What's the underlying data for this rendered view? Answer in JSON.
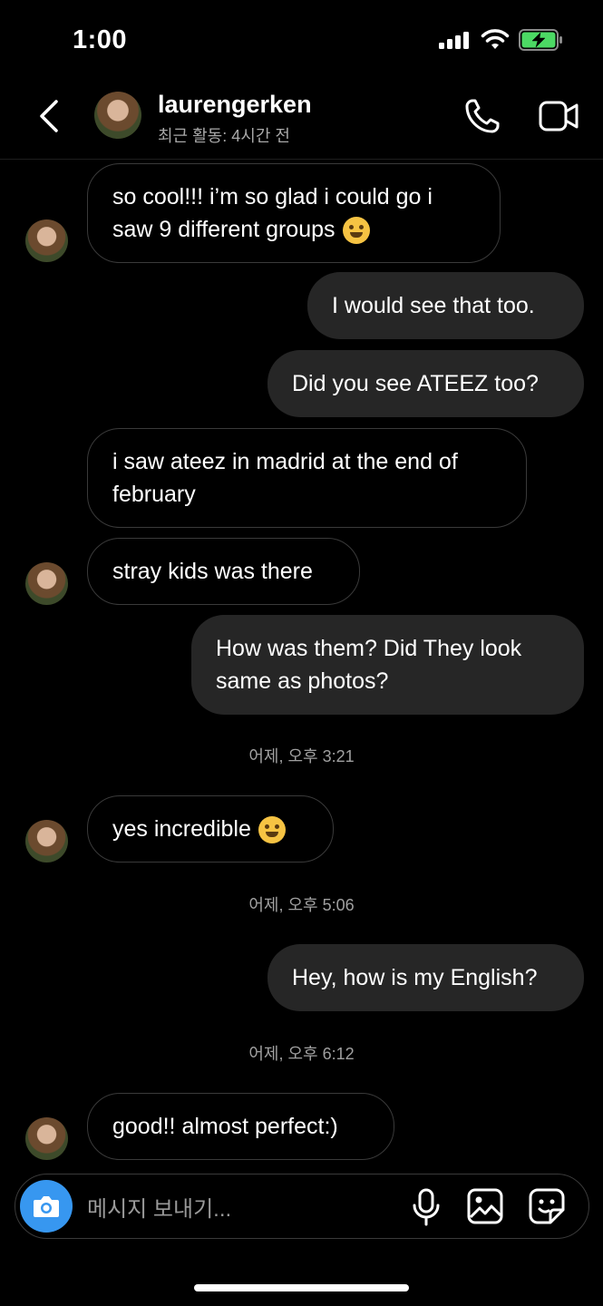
{
  "status": {
    "time": "1:00"
  },
  "header": {
    "username": "laurengerken",
    "activity": "최근 활동: 4시간 전"
  },
  "messages": [
    {
      "from": "them",
      "text": "so cool!!! i’m so glad i could go i saw 9 different groups"
    },
    {
      "from": "me",
      "text": "I would see that too."
    },
    {
      "from": "me",
      "text": "Did you see ATEEZ too?"
    },
    {
      "from": "them",
      "text": "i saw ateez in madrid at the end of february"
    },
    {
      "from": "them",
      "text": "stray kids was there"
    },
    {
      "from": "me",
      "text": "How was them? Did They look same as photos?"
    },
    {
      "from": "them",
      "text": "yes incredible"
    },
    {
      "from": "me",
      "text": "Hey, how is my English?"
    },
    {
      "from": "them",
      "text": "good!! almost perfect:)"
    }
  ],
  "timestamps": [
    "어제, 오후 3:21",
    "어제, 오후 5:06",
    "어제, 오후 6:12"
  ],
  "composer": {
    "placeholder": "메시지 보내기..."
  },
  "colors": {
    "accent": "#3797f0",
    "outgoing_bubble": "#262626",
    "incoming_border": "#3a3a3a"
  }
}
